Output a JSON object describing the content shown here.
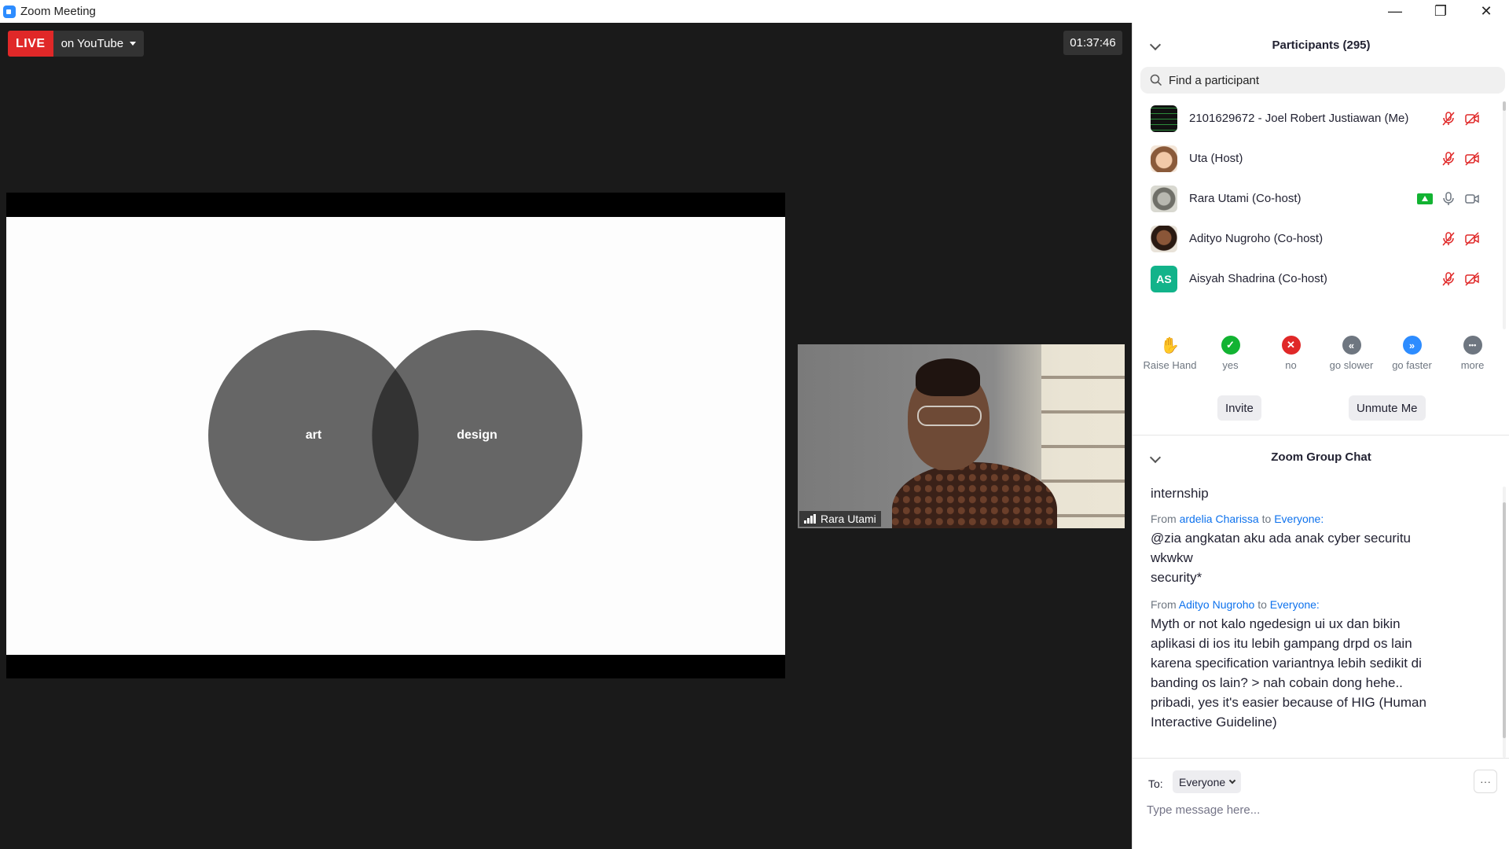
{
  "window": {
    "title": "Zoom Meeting",
    "controls": {
      "minimize": "—",
      "restore": "❐",
      "close": "✕"
    }
  },
  "stage": {
    "live_label": "LIVE",
    "stream_target": "on YouTube",
    "timer": "01:37:46",
    "slide": {
      "left_label": "art",
      "right_label": "design"
    },
    "video_name": "Rara Utami"
  },
  "participants": {
    "title": "Participants (295)",
    "search_placeholder": "Find a participant",
    "list": [
      {
        "name": "2101629672 - Joel Robert Justiawan (Me)",
        "avatar": "code-screen",
        "muted": true,
        "video_off": true,
        "sharing": false
      },
      {
        "name": "Uta (Host)",
        "avatar": "memoji",
        "muted": true,
        "video_off": true,
        "sharing": false
      },
      {
        "name": "Rara Utami (Co-host)",
        "avatar": "photo",
        "muted": false,
        "video_off": false,
        "sharing": true
      },
      {
        "name": "Adityo Nugroho (Co-host)",
        "avatar": "photo",
        "muted": true,
        "video_off": true,
        "sharing": false
      },
      {
        "name": "Aisyah Shadrina (Co-host)",
        "avatar": "AS",
        "muted": true,
        "video_off": true,
        "sharing": false
      }
    ],
    "reactions": [
      {
        "label": "Raise Hand",
        "icon": "hand-icon",
        "glyph": "✋",
        "color": "#2d8cff"
      },
      {
        "label": "yes",
        "icon": "check-icon",
        "glyph": "✓",
        "color": "#12b332"
      },
      {
        "label": "no",
        "icon": "x-icon",
        "glyph": "✕",
        "color": "#e02828"
      },
      {
        "label": "go slower",
        "icon": "rewind-icon",
        "glyph": "«",
        "color": "#6e7680"
      },
      {
        "label": "go faster",
        "icon": "fast-forward-icon",
        "glyph": "»",
        "color": "#2d8cff"
      },
      {
        "label": "more",
        "icon": "more-icon",
        "glyph": "•••",
        "color": "#6e7680"
      }
    ],
    "invite_label": "Invite",
    "unmute_label": "Unmute Me"
  },
  "chat": {
    "title": "Zoom Group Chat",
    "partial_text": "internship",
    "messages": [
      {
        "from_prefix": "From",
        "sender": "ardelia Charissa",
        "to_word": "to",
        "recipient": "Everyone:",
        "text": "@zia angkatan aku ada anak cyber securitu\nwkwkw\nsecurity*"
      },
      {
        "from_prefix": "From",
        "sender": "Adityo Nugroho",
        "to_word": "to",
        "recipient": "Everyone:",
        "text": "Myth or not kalo ngedesign ui ux dan bikin\naplikasi di ios itu lebih gampang drpd os lain\nkarena specification variantnya lebih sedikit di\nbanding os lain? > nah cobain dong hehe..\npribadi, yes it's easier because of HIG (Human\nInteractive Guideline)"
      }
    ],
    "to_label": "To:",
    "to_value": "Everyone",
    "more_label": "···",
    "input_placeholder": "Type message here..."
  },
  "colors": {
    "accent": "#0e72ed",
    "live": "#e02828",
    "mute_red": "#e02828",
    "share_green": "#12b332",
    "aisyah_avatar": "#12b38a"
  }
}
